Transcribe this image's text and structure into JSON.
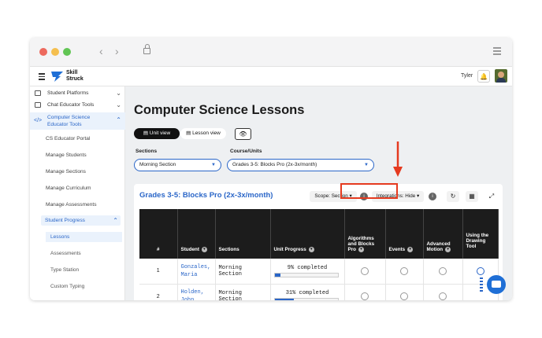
{
  "window": {
    "back_glyph": "‹",
    "forward_glyph": "›"
  },
  "header": {
    "logo_line1": "Skill",
    "logo_line2": "Struck",
    "username": "Tyler",
    "brand_color": "#1f6fd6"
  },
  "sidebar": {
    "items": [
      {
        "label": "Student Platforms"
      },
      {
        "label": "Chat Educator Tools"
      },
      {
        "label": "Computer Science Educator Tools"
      }
    ],
    "cs_items": [
      {
        "label": "CS Educator Portal"
      },
      {
        "label": "Manage Students"
      },
      {
        "label": "Manage Sections"
      },
      {
        "label": "Manage Curriculum"
      },
      {
        "label": "Manage Assessments"
      },
      {
        "label": "Student Progress"
      }
    ],
    "progress_items": [
      {
        "label": "Lessons"
      },
      {
        "label": "Assessments"
      },
      {
        "label": "Type Station"
      },
      {
        "label": "Custom Typing"
      }
    ]
  },
  "main": {
    "title": "Computer Science Lessons",
    "unit_view": "Unit view",
    "lesson_view": "Lesson view",
    "sections_label": "Sections",
    "sections_value": "Morning Section",
    "course_label": "Course/Units",
    "course_value": "Grades 3-5: Blocks Pro (2x-3x/month)"
  },
  "card": {
    "title": "Grades 3-5: Blocks Pro (2x-3x/month)",
    "scope": "Scope: Section ▾",
    "integrations": "Integrations: Hide ▾",
    "columns": [
      "#",
      "Student",
      "Sections",
      "Unit Progress",
      "Algorithms and Blocks Pro",
      "Events",
      "Advanced Motion",
      "Using the Drawing Tool"
    ],
    "rows": [
      {
        "num": "1",
        "student": "Gonzales, Maria",
        "section": "Morning Section",
        "progress_text": "9% completed",
        "progress": 0.09
      },
      {
        "num": "2",
        "student": "Holden, John",
        "section": "Morning Section",
        "progress_text": "31% completed",
        "progress": 0.31
      }
    ]
  },
  "colors": {
    "accent": "#2a66c8",
    "annotation": "#e53a1f"
  }
}
